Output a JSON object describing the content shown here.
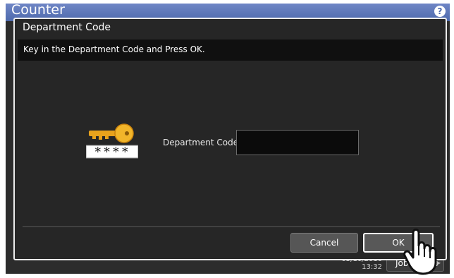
{
  "app": {
    "title": "Counter",
    "help_label": "?"
  },
  "statusbar": {
    "date": "05/10/2016",
    "time": "13:32",
    "job_status_label": "Job Status"
  },
  "dialog": {
    "title": "Department Code",
    "message": "Key in the Department Code and Press OK.",
    "field_label": "Department Code",
    "field_value": "",
    "masked_code": "****",
    "cancel_label": "Cancel",
    "ok_label": "OK"
  },
  "icons": {
    "key": "key-icon",
    "pointer": "hand-pointer-icon",
    "help": "help-icon"
  },
  "colors": {
    "titlebar": "#5b74b8",
    "dialog_bg": "#262626",
    "message_bg": "#101010",
    "key_gold": "#e8a21c"
  }
}
